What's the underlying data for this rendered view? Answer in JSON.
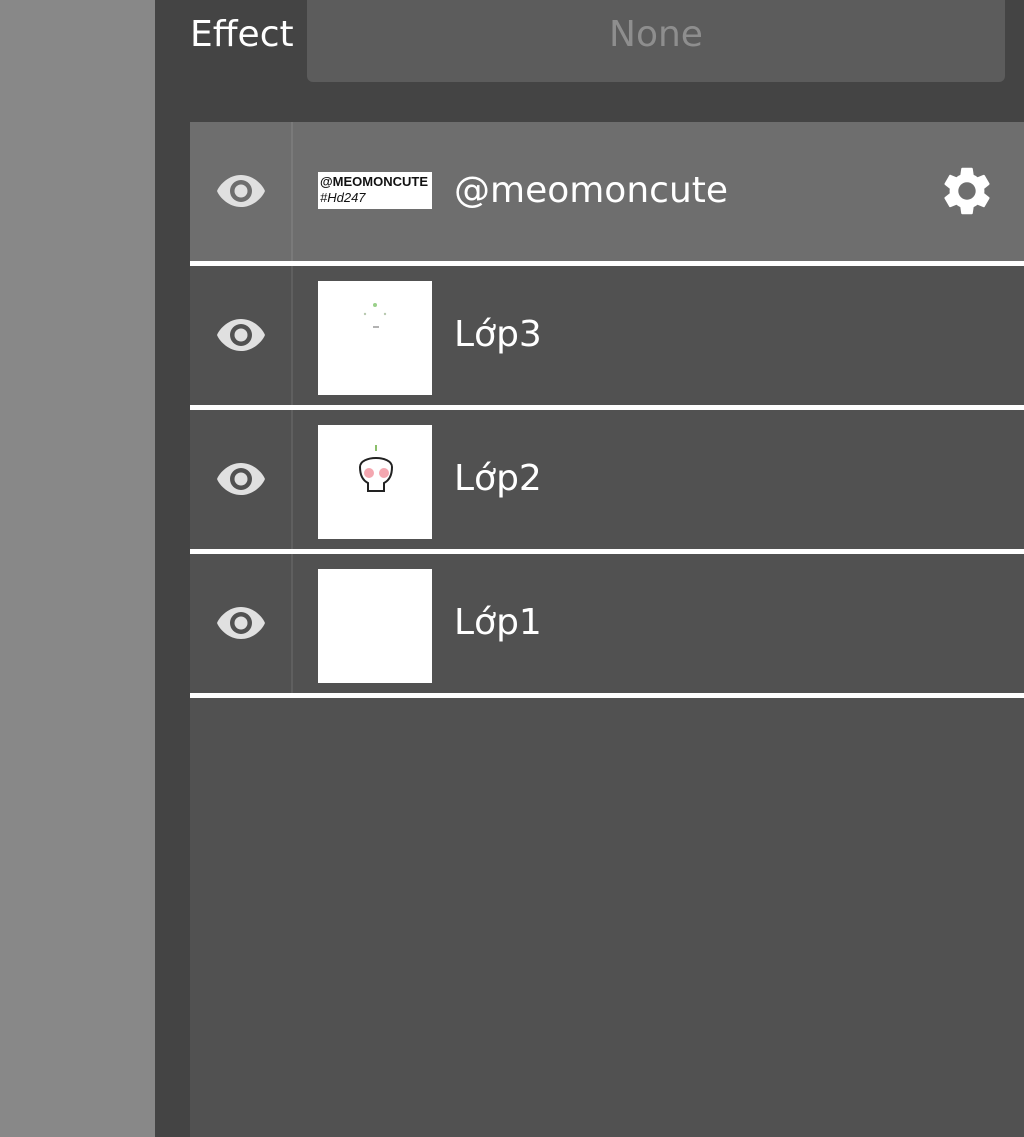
{
  "effect": {
    "label": "Effect",
    "value": "None"
  },
  "layers": [
    {
      "name": "@meomoncute",
      "thumb_text_line1": "@MEOMONCUTE",
      "thumb_text_line2": "#Hd247",
      "selected": true,
      "visible": true,
      "icon": "eye-icon"
    },
    {
      "name": "Lớp3",
      "selected": false,
      "visible": true,
      "icon": "eye-icon"
    },
    {
      "name": "Lớp2",
      "selected": false,
      "visible": true,
      "icon": "eye-icon"
    },
    {
      "name": "Lớp1",
      "selected": false,
      "visible": true,
      "icon": "eye-icon"
    }
  ],
  "icons": {
    "visibility": "eye-icon",
    "settings": "gear-icon"
  },
  "colors": {
    "panel_bg": "#444444",
    "list_bg": "#515151",
    "selected_row_bg": "#6e6e6e",
    "canvas_bg": "#888888",
    "divider": "#ffffff",
    "effect_value_text": "#8e8e8e"
  }
}
